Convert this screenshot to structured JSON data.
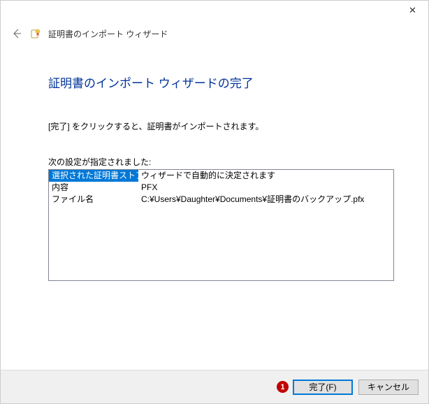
{
  "titlebar": {
    "close_glyph": "✕"
  },
  "header": {
    "back_arrow": "←",
    "wizard_title": "証明書のインポート ウィザード"
  },
  "main": {
    "heading": "証明書のインポート ウィザードの完了",
    "instruction": "[完了] をクリックすると、証明書がインポートされます。",
    "settings_label": "次の設定が指定されました:",
    "settings_rows": [
      {
        "key": "選択された証明書ストア",
        "value": "ウィザードで自動的に決定されます",
        "selected": true
      },
      {
        "key": "内容",
        "value": "PFX",
        "selected": false
      },
      {
        "key": "ファイル名",
        "value": "C:¥Users¥Daughter¥Documents¥証明書のバックアップ.pfx",
        "selected": false
      }
    ]
  },
  "footer": {
    "annotation_number": "1",
    "finish_label": "完了(F)",
    "cancel_label": "キャンセル"
  }
}
